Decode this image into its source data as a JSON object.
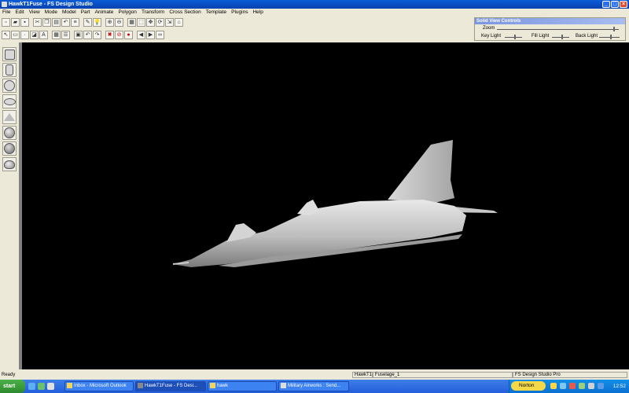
{
  "window": {
    "title": "HawkT1Fuse - FS Design Studio"
  },
  "menu": [
    "File",
    "Edit",
    "View",
    "Mode",
    "Model",
    "Part",
    "Animate",
    "Polygon",
    "Transform",
    "Cross Section",
    "Template",
    "Plugins",
    "Help"
  ],
  "toolbar1": [
    "new",
    "open",
    "save",
    "cut",
    "copy",
    "paste",
    "undo",
    "redo",
    "light",
    "zoom-in",
    "zoom-out",
    "grid",
    "select",
    "move",
    "rotate",
    "scale",
    "mirror"
  ],
  "toolbar2": [
    "arrow",
    "rect",
    "dot",
    "fill",
    "text",
    "grid",
    "lines",
    "box",
    "undo",
    "redo",
    "del",
    "stop",
    "rec",
    "prev",
    "next",
    "bino"
  ],
  "solid_view": {
    "title": "Solid View Controls",
    "zoom_label": "Zoom",
    "key_light_label": "Key Light",
    "fill_light_label": "Fill Light",
    "back_light_label": "Back Light"
  },
  "palette": [
    "cube",
    "cylinder",
    "sphere",
    "disc",
    "pyramid",
    "dome",
    "hemisphere",
    "cone"
  ],
  "status": {
    "left": "Ready",
    "model": "HawkT1",
    "part": "Fuselage_1",
    "app": "FS Design Studio Pro"
  },
  "taskbar": {
    "start_label": "start",
    "tasks": [
      {
        "label": "Inbox - Microsoft Outlook"
      },
      {
        "label": "HawkT1Fuse - FS Desi..."
      },
      {
        "label": "hawk"
      },
      {
        "label": "Military Airworks : Send..."
      }
    ],
    "norton_label": "Norton",
    "clock": "12:52"
  },
  "colors": {
    "accent": "#245edc",
    "viewport_bg": "#000000",
    "model_fill": "#bdbdbd"
  }
}
